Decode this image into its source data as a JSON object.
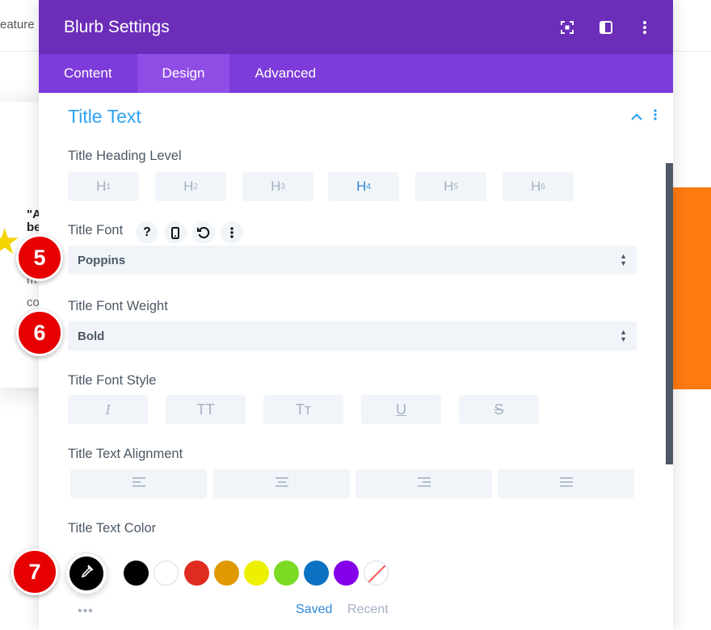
{
  "background": {
    "nav_fragment": "eature",
    "quote_line1": "\"A",
    "quote_line2": "be",
    "small_1": "m",
    "small_2": "co"
  },
  "modal": {
    "title": "Blurb Settings",
    "header_icons": [
      "expand-icon",
      "sidebar-icon",
      "more-vertical-icon"
    ],
    "tabs": [
      {
        "label": "Content",
        "active": false
      },
      {
        "label": "Design",
        "active": true
      },
      {
        "label": "Advanced",
        "active": false
      }
    ]
  },
  "section": {
    "title": "Title Text"
  },
  "heading_level": {
    "label": "Title Heading Level",
    "options": [
      {
        "letter": "H",
        "num": "1"
      },
      {
        "letter": "H",
        "num": "2"
      },
      {
        "letter": "H",
        "num": "3"
      },
      {
        "letter": "H",
        "num": "4"
      },
      {
        "letter": "H",
        "num": "5"
      },
      {
        "letter": "H",
        "num": "6"
      }
    ],
    "selected": "H4"
  },
  "title_font": {
    "label": "Title Font",
    "value": "Poppins",
    "icons": [
      "help-icon",
      "mobile-icon",
      "reset-icon",
      "more-vertical-icon"
    ]
  },
  "font_weight": {
    "label": "Title Font Weight",
    "value": "Bold"
  },
  "font_style": {
    "label": "Title Font Style",
    "options": [
      "I",
      "TT",
      "Tт",
      "U",
      "S"
    ]
  },
  "alignment": {
    "label": "Title Text Alignment",
    "options": [
      "align-left-icon",
      "align-center-icon",
      "align-right-icon",
      "align-justify-icon"
    ]
  },
  "text_color": {
    "label": "Title Text Color",
    "swatches": [
      "#000000",
      "#ffffff",
      "#e02b20",
      "#e09900",
      "#edf000",
      "#7cda24",
      "#0c71c3",
      "#8300e9",
      "none"
    ],
    "saved_label": "Saved",
    "recent_label": "Recent",
    "more": "•••"
  },
  "badges": [
    "5",
    "6",
    "7"
  ]
}
